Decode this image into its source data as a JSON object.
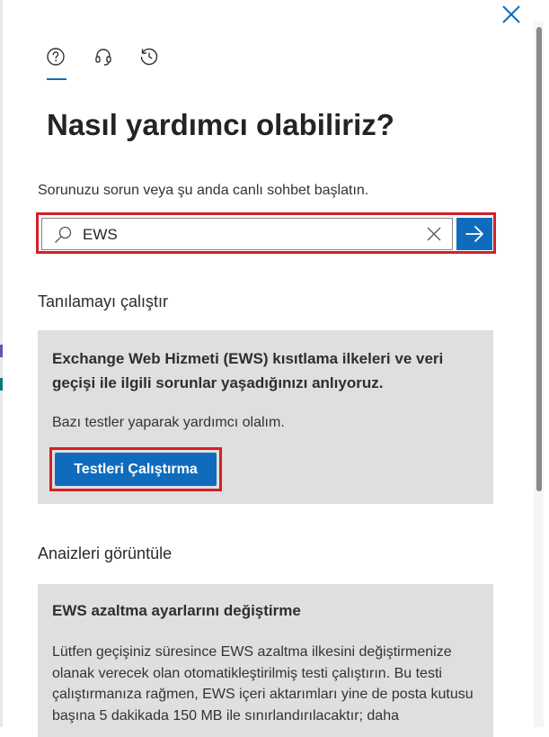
{
  "header": {
    "tabs": [
      {
        "name": "help",
        "icon": "question-circle-icon",
        "selected": true
      },
      {
        "name": "contact-support",
        "icon": "headset-icon",
        "selected": false
      },
      {
        "name": "history",
        "icon": "history-icon",
        "selected": false
      }
    ],
    "close_icon": "close-icon"
  },
  "main": {
    "title": "Nasıl yardımcı olabiliriz?",
    "subtitle": "Sorunuzu sorun veya şu anda canlı sohbet başlatın.",
    "search": {
      "value": "EWS",
      "search_icon": "search-icon",
      "clear_icon": "close-icon",
      "submit_icon": "arrow-right-icon"
    },
    "diagnostics": {
      "heading": "Tanılamayı çalıştır",
      "card": {
        "title": "Exchange Web Hizmeti (EWS) kısıtlama ilkeleri ve veri geçişi ile ilgili sorunlar yaşadığınızı anlıyoruz.",
        "text": "Bazı testler yaparak yardımcı olalım.",
        "button_label": "Testleri Çalıştırma"
      }
    },
    "insights": {
      "heading": "Anaizleri görüntüle",
      "card": {
        "title": "EWS azaltma ayarlarını değiştirme",
        "text": "Lütfen geçişiniz süresince EWS azaltma ilkesini değiştirmenize olanak verecek olan otomatikleştirilmiş testi çalıştırın. Bu testi çalıştırmanıza rağmen, EWS içeri aktarımları yine de posta kutusu başına 5 dakikada 150 MB ile sınırlandırılacaktır; daha"
      }
    }
  },
  "colors": {
    "accent": "#0f6cbd",
    "highlight_outline": "#d42027",
    "card_background": "#dfdfdf"
  }
}
